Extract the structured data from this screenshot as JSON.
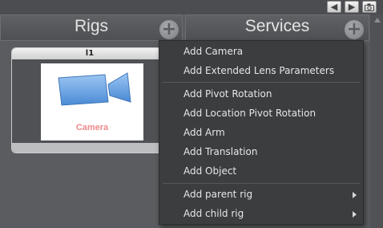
{
  "toolbar": {
    "back_icon": "arrow-left-icon",
    "forward_icon": "arrow-right-icon",
    "camera_icon": "camera-icon"
  },
  "rigs_panel": {
    "title": "Rigs"
  },
  "services_panel": {
    "title": "Services"
  },
  "rig_card": {
    "name": "l1",
    "thumbnail_caption": "Camera"
  },
  "context_menu": {
    "items": [
      "Add Camera",
      "Add Extended Lens Parameters",
      "Add Pivot Rotation",
      "Add Location Pivot Rotation",
      "Add Arm",
      "Add Translation",
      "Add Object",
      "Add parent rig",
      "Add child rig"
    ]
  },
  "colors": {
    "background": "#5a5c5f",
    "menu_background": "#3c3d3f",
    "menu_text": "#e6e6e6",
    "caption_red": "#ee8a8a",
    "camera_blue": "#6aa6e6"
  }
}
